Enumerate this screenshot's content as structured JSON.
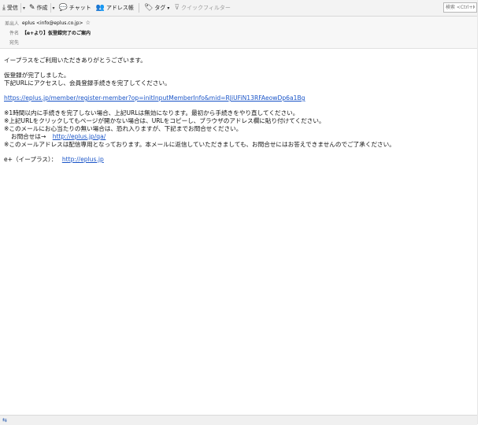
{
  "toolbar": {
    "receive": "受信",
    "compose": "作成",
    "chat": "チャット",
    "address_book": "アドレス帳",
    "tag": "タグ",
    "quick_filter": "クイックフィルター",
    "search_placeholder": "検索 <Ctrl+K>"
  },
  "header": {
    "from_label": "差出人",
    "from_value": "eplus <info@eplus.co.jp>",
    "subject_label": "件名",
    "subject_value": "【e+より】仮登録完了のご案内",
    "to_label": "宛先"
  },
  "body": {
    "greeting": "イープラスをご利用いただきありがとうございます。",
    "line_registered": "仮登録が完了しました。",
    "line_instruction": "下記URLにアクセスし、会員登録手続きを完了してください。",
    "register_url": "https://eplus.jp/member/register-member?op=initInputMemberInfo&mid=RJiUFiN13RFAeowDp6a1Bg",
    "note1": "※1時間以内に手続きを完了しない場合、上記URLは無効になります。最初から手続きをやり直してください。",
    "note2": "※上記URLをクリックしてもページが開かない場合は、URLをコピーし、ブラウザのアドレス欄に貼り付けてください。",
    "note3": "※このメールにお心当たりの無い場合は、恐れ入りますが、下記までお問合せください。",
    "inquiry_label": "お問合せは→",
    "inquiry_url": "http://eplus.jp/qa/",
    "note4": "※このメールアドレスは配信専用となっております。本メールに返信していただきましても、お問合せにはお答えできませんのでご了承ください。",
    "signature_label": "e+（イープラス）：",
    "signature_url": "http://eplus.jp"
  }
}
